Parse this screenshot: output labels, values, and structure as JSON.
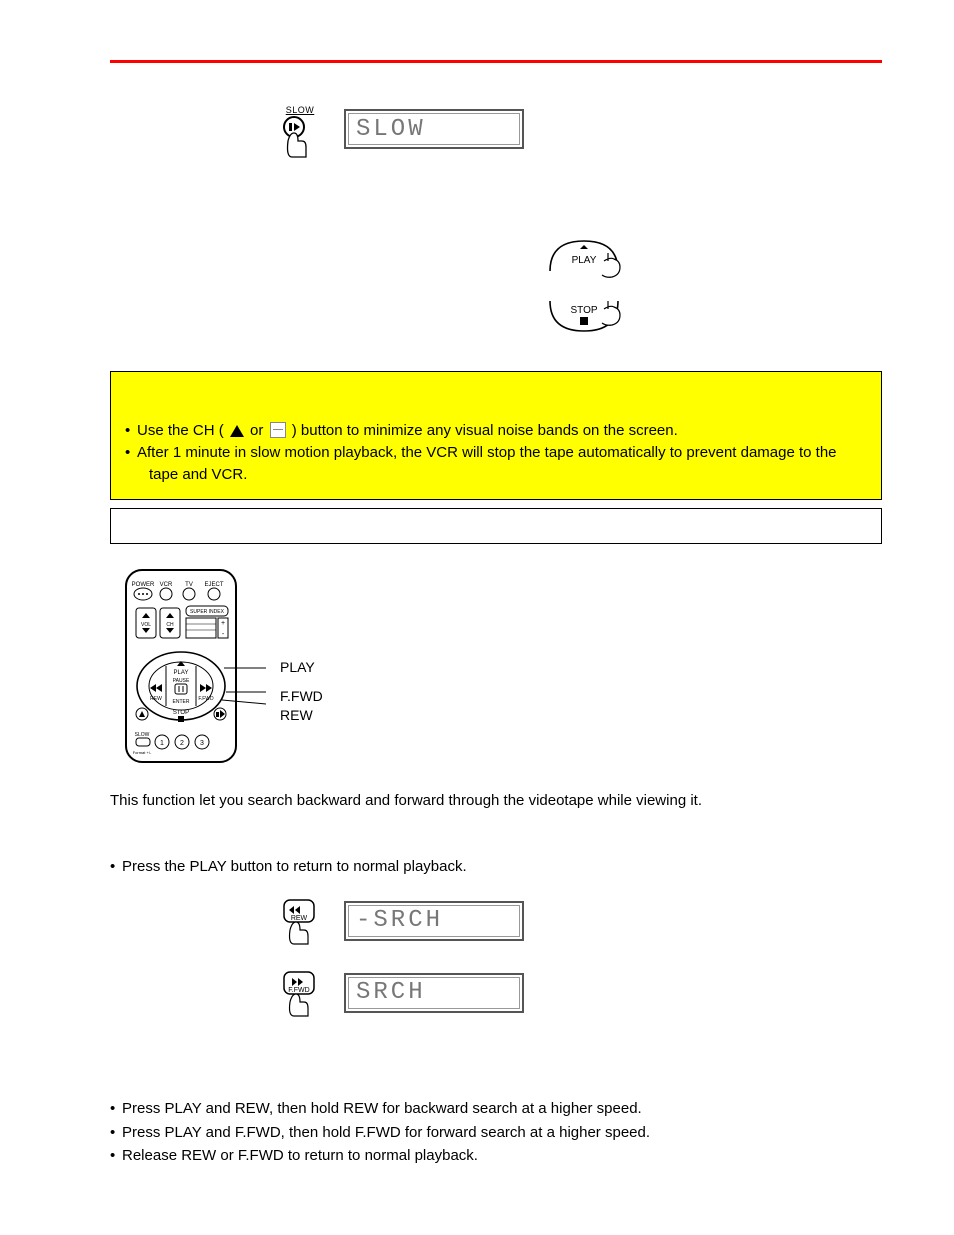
{
  "icons": {
    "slow_caption": "SLOW",
    "play_caption": "PLAY",
    "stop_caption": "STOP",
    "rew_caption": "REW",
    "ffwd_caption": "F.FWD"
  },
  "displays": {
    "slow": "SLOW",
    "srch_back": "-SRCH",
    "srch_fwd": "SRCH"
  },
  "note": {
    "line1_pre": "Use the CH (",
    "line1_mid": " or ",
    "line1_post": ") button to minimize any visual noise bands on the screen.",
    "line2a": "After 1 minute in slow motion playback, the VCR will stop the tape automatically to prevent damage to the",
    "line2b": "tape and VCR."
  },
  "remote_labels": {
    "play": "PLAY",
    "ffwd": "F.FWD",
    "rew": "REW"
  },
  "remote_top": {
    "power": "POWER",
    "vcr": "VCR",
    "tv": "TV",
    "eject": "EJECT"
  },
  "body": {
    "intro": "This function let you search backward and forward through the videotape while viewing it.",
    "press_play": "Press the PLAY button to return to normal playback.",
    "b1": "Press PLAY and REW, then hold REW for backward search at a higher speed.",
    "b2": "Press PLAY and F.FWD, then hold F.FWD for forward search at a higher speed.",
    "b3": "Release REW or F.FWD to return to normal playback."
  }
}
